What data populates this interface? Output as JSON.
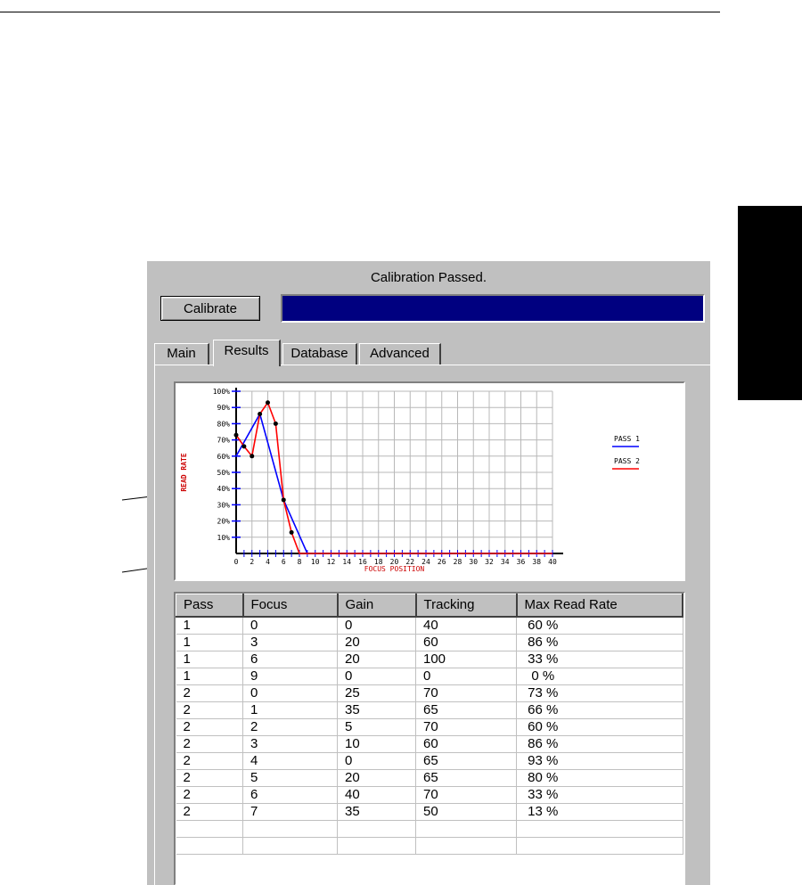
{
  "window": {
    "status": "Calibration Passed.",
    "calibrate_label": "Calibrate",
    "progress_fraction": 1.0,
    "progress_color": "#000080"
  },
  "tabs": [
    {
      "label": "Main",
      "active": false
    },
    {
      "label": "Results",
      "active": true
    },
    {
      "label": "Database",
      "active": false
    },
    {
      "label": "Advanced",
      "active": false
    }
  ],
  "chart_data": {
    "type": "line",
    "xlabel": "FOCUS POSITION",
    "ylabel": "READ RATE",
    "xlim": [
      0,
      40
    ],
    "ylim": [
      0,
      100
    ],
    "x_ticks": [
      "0",
      "2",
      "4",
      "6",
      "8",
      "10",
      "12",
      "14",
      "16",
      "18",
      "20",
      "22",
      "24",
      "26",
      "28",
      "30",
      "32",
      "34",
      "36",
      "38",
      "40"
    ],
    "y_ticks": [
      "10%",
      "20%",
      "30%",
      "40%",
      "50%",
      "60%",
      "70%",
      "80%",
      "90%",
      "100%"
    ],
    "grid": true,
    "legend_position": "right",
    "series": [
      {
        "name": "PASS 1",
        "color": "#0000ff",
        "markers": false,
        "points": [
          [
            0,
            60
          ],
          [
            3,
            86
          ],
          [
            6,
            33
          ],
          [
            9,
            0
          ],
          [
            40,
            0
          ]
        ]
      },
      {
        "name": "PASS 2",
        "color": "#ff0000",
        "markers": true,
        "points": [
          [
            0,
            73
          ],
          [
            1,
            66
          ],
          [
            2,
            60
          ],
          [
            3,
            86
          ],
          [
            4,
            93
          ],
          [
            5,
            80
          ],
          [
            6,
            33
          ],
          [
            7,
            13
          ],
          [
            8,
            0
          ],
          [
            40,
            0
          ]
        ]
      }
    ]
  },
  "table": {
    "columns": [
      "Pass",
      "Focus",
      "Gain",
      "Tracking",
      "Max Read Rate"
    ],
    "rows": [
      [
        "1",
        "0",
        "0",
        "40",
        " 60 %"
      ],
      [
        "1",
        "3",
        "20",
        "60",
        " 86 %"
      ],
      [
        "1",
        "6",
        "20",
        "100",
        " 33 %"
      ],
      [
        "1",
        "9",
        "0",
        "0",
        "  0 %"
      ],
      [
        "2",
        "0",
        "25",
        "70",
        " 73 %"
      ],
      [
        "2",
        "1",
        "35",
        "65",
        " 66 %"
      ],
      [
        "2",
        "2",
        "5",
        "70",
        " 60 %"
      ],
      [
        "2",
        "3",
        "10",
        "60",
        " 86 %"
      ],
      [
        "2",
        "4",
        "0",
        "65",
        " 93 %"
      ],
      [
        "2",
        "5",
        "20",
        "65",
        " 80 %"
      ],
      [
        "2",
        "6",
        "40",
        "70",
        " 33 %"
      ],
      [
        "2",
        "7",
        "35",
        "50",
        " 13 %"
      ],
      [
        "",
        "",
        "",
        "",
        ""
      ],
      [
        "",
        "",
        "",
        "",
        ""
      ]
    ]
  }
}
